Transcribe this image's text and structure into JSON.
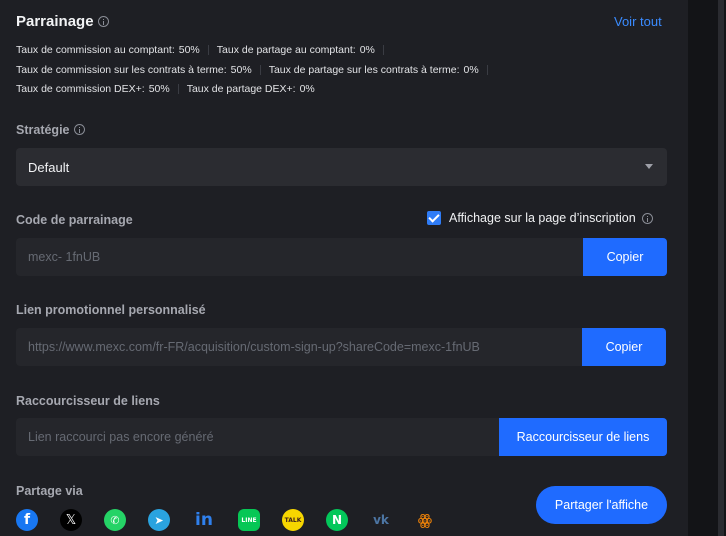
{
  "header": {
    "title": "Parrainage",
    "view_all": "Voir tout"
  },
  "rates": [
    {
      "left_label": "Taux de commission au comptant:",
      "left_value": "50%",
      "right_label": "Taux de partage au comptant:",
      "right_value": "0%"
    },
    {
      "left_label": "Taux de commission sur les contrats à terme:",
      "left_value": "50%",
      "right_label": "Taux de partage sur les contrats à terme:",
      "right_value": "0%"
    },
    {
      "left_label": "Taux de commission DEX+:",
      "left_value": "50%",
      "right_label": "Taux de partage DEX+:",
      "right_value": "0%"
    }
  ],
  "strategy": {
    "label": "Stratégie",
    "selected": "Default"
  },
  "referral_code": {
    "label": "Code de parrainage",
    "checkbox_label": "Affichage sur la page d’inscription",
    "checked": true,
    "value": "mexc-   1fnUB",
    "copy_label": "Copier"
  },
  "promo_link": {
    "label": "Lien promotionnel personnalisé",
    "value": "https://www.mexc.com/fr-FR/acquisition/custom-sign-up?shareCode=mexc-1fnUB",
    "copy_label": "Copier"
  },
  "shortener": {
    "label": "Raccourcisseur de liens",
    "placeholder": "Lien raccourci pas encore généré",
    "button_label": "Raccourcisseur de liens"
  },
  "share": {
    "label": "Partage via",
    "icons": [
      "facebook-icon",
      "x-icon",
      "whatsapp-icon",
      "telegram-icon",
      "linkedin-icon",
      "line-icon",
      "kakaotalk-icon",
      "naver-icon",
      "vk-icon",
      "odnoklassniki-icon"
    ],
    "poster_label": "Partager l'affiche"
  },
  "colors": {
    "accent": "#1f6bff",
    "link": "#3a8bff",
    "background": "#1e1f24"
  }
}
